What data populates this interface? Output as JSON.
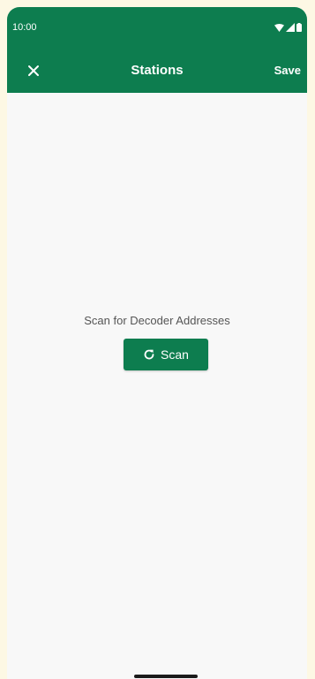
{
  "status_bar": {
    "time": "10:00",
    "icons": [
      "wifi-icon",
      "cellular-signal-icon",
      "battery-icon"
    ]
  },
  "toolbar": {
    "title": "Stations",
    "save_label": "Save",
    "close_icon": "close-icon"
  },
  "main": {
    "caption": "Scan for Decoder Addresses",
    "scan_button_label": "Scan",
    "scan_icon": "refresh-icon"
  },
  "colors": {
    "primary": "#0d7d4f",
    "background": "#f8f8f8",
    "outer_background": "#fdf8e4",
    "caption_text": "#555555"
  }
}
